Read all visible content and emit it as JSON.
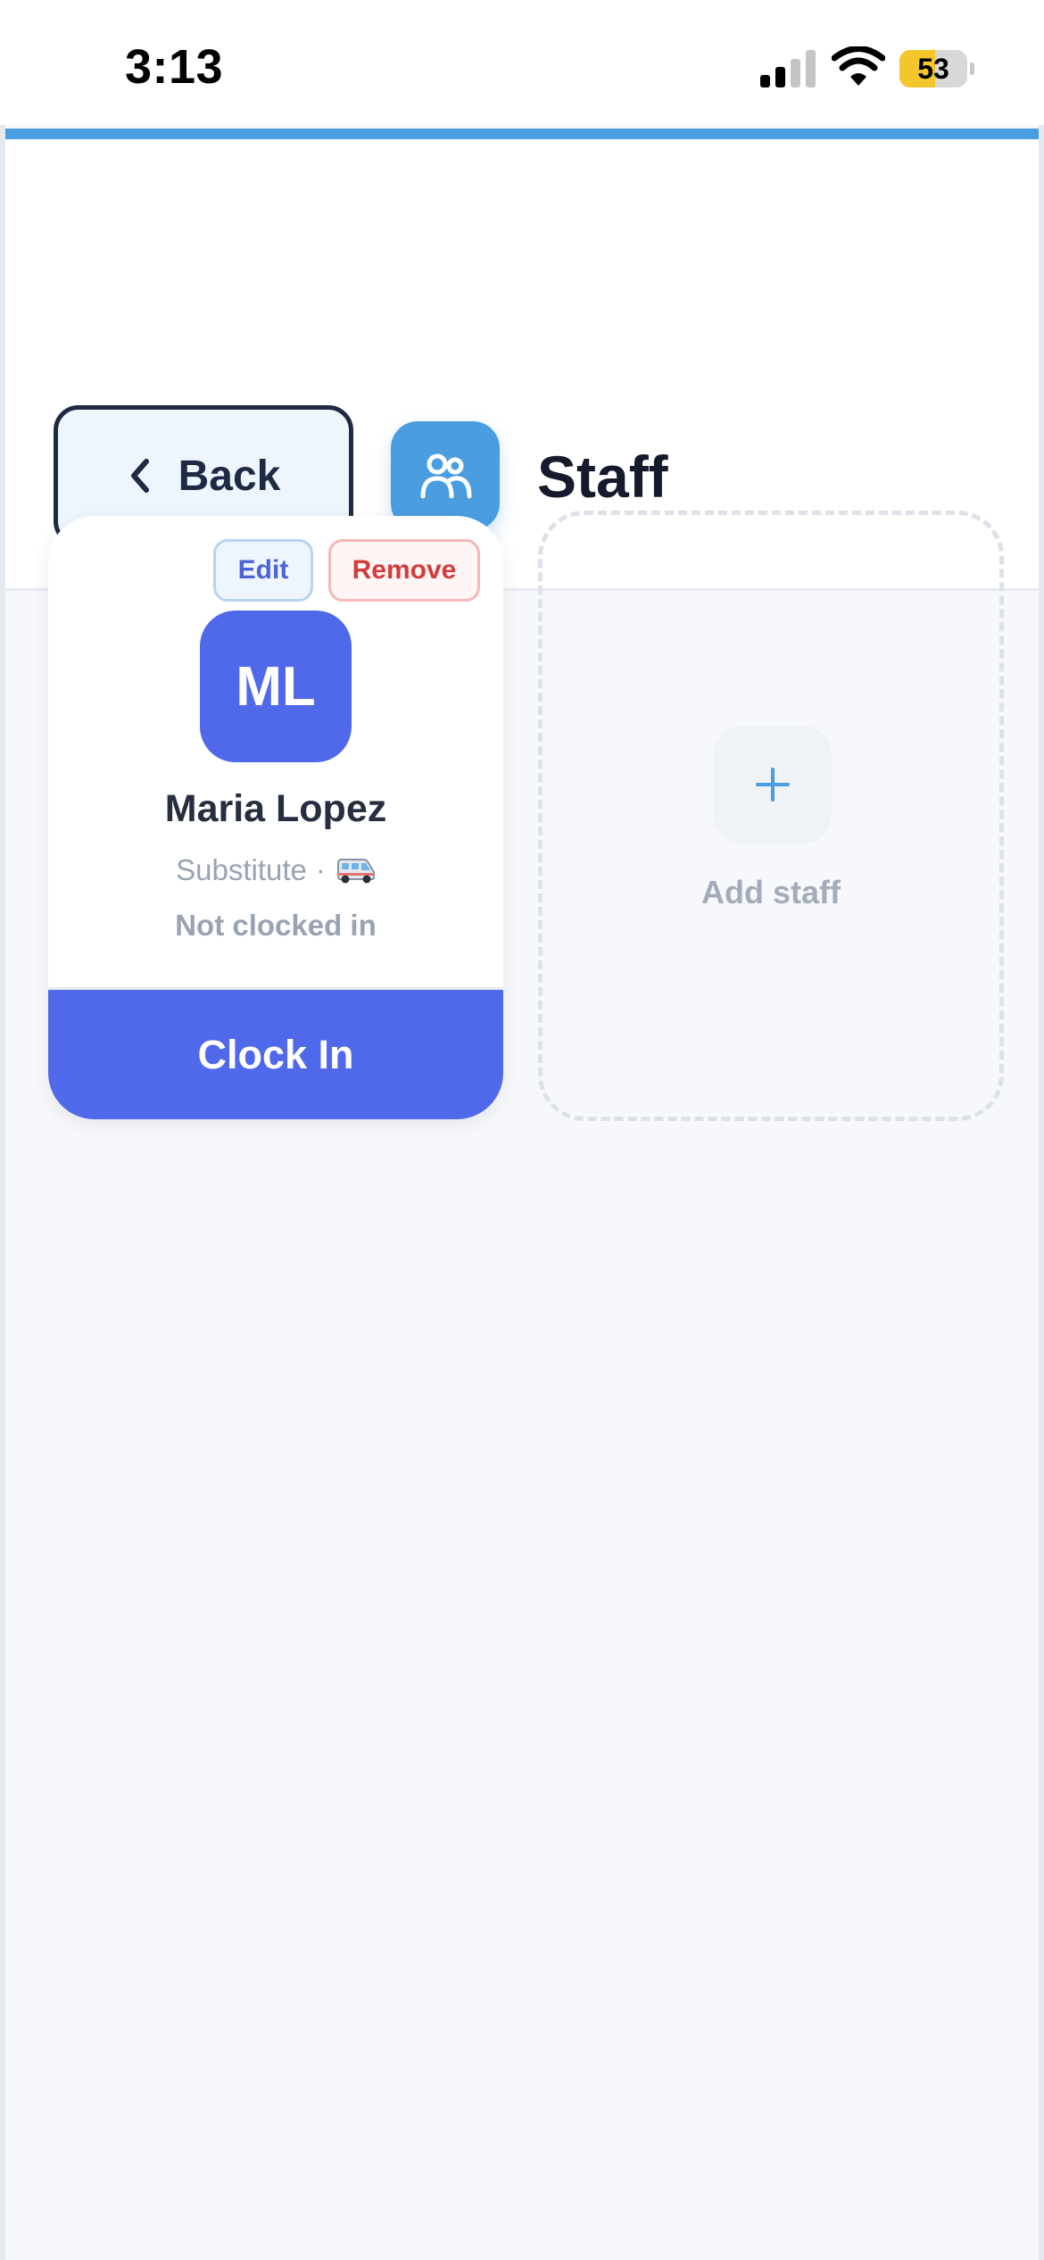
{
  "status_bar": {
    "time": "3:13",
    "battery_level": "53",
    "battery_fraction": 0.53,
    "battery_color": "#f5c52c"
  },
  "header": {
    "accent_color": "#4a9ee0",
    "back_label": "Back",
    "back_icon": "chevron-left-icon",
    "page_icon": "people-icon",
    "title": "Staff"
  },
  "staff": [
    {
      "initials": "ML",
      "name": "Maria Lopez",
      "role": "Substitute",
      "separator": "·",
      "role_icon": "van-icon",
      "status": "Not clocked in",
      "edit_label": "Edit",
      "remove_label": "Remove",
      "action_label": "Clock In",
      "avatar_color": "#5069ea"
    }
  ],
  "add_staff": {
    "icon": "plus-icon",
    "label": "Add staff"
  }
}
